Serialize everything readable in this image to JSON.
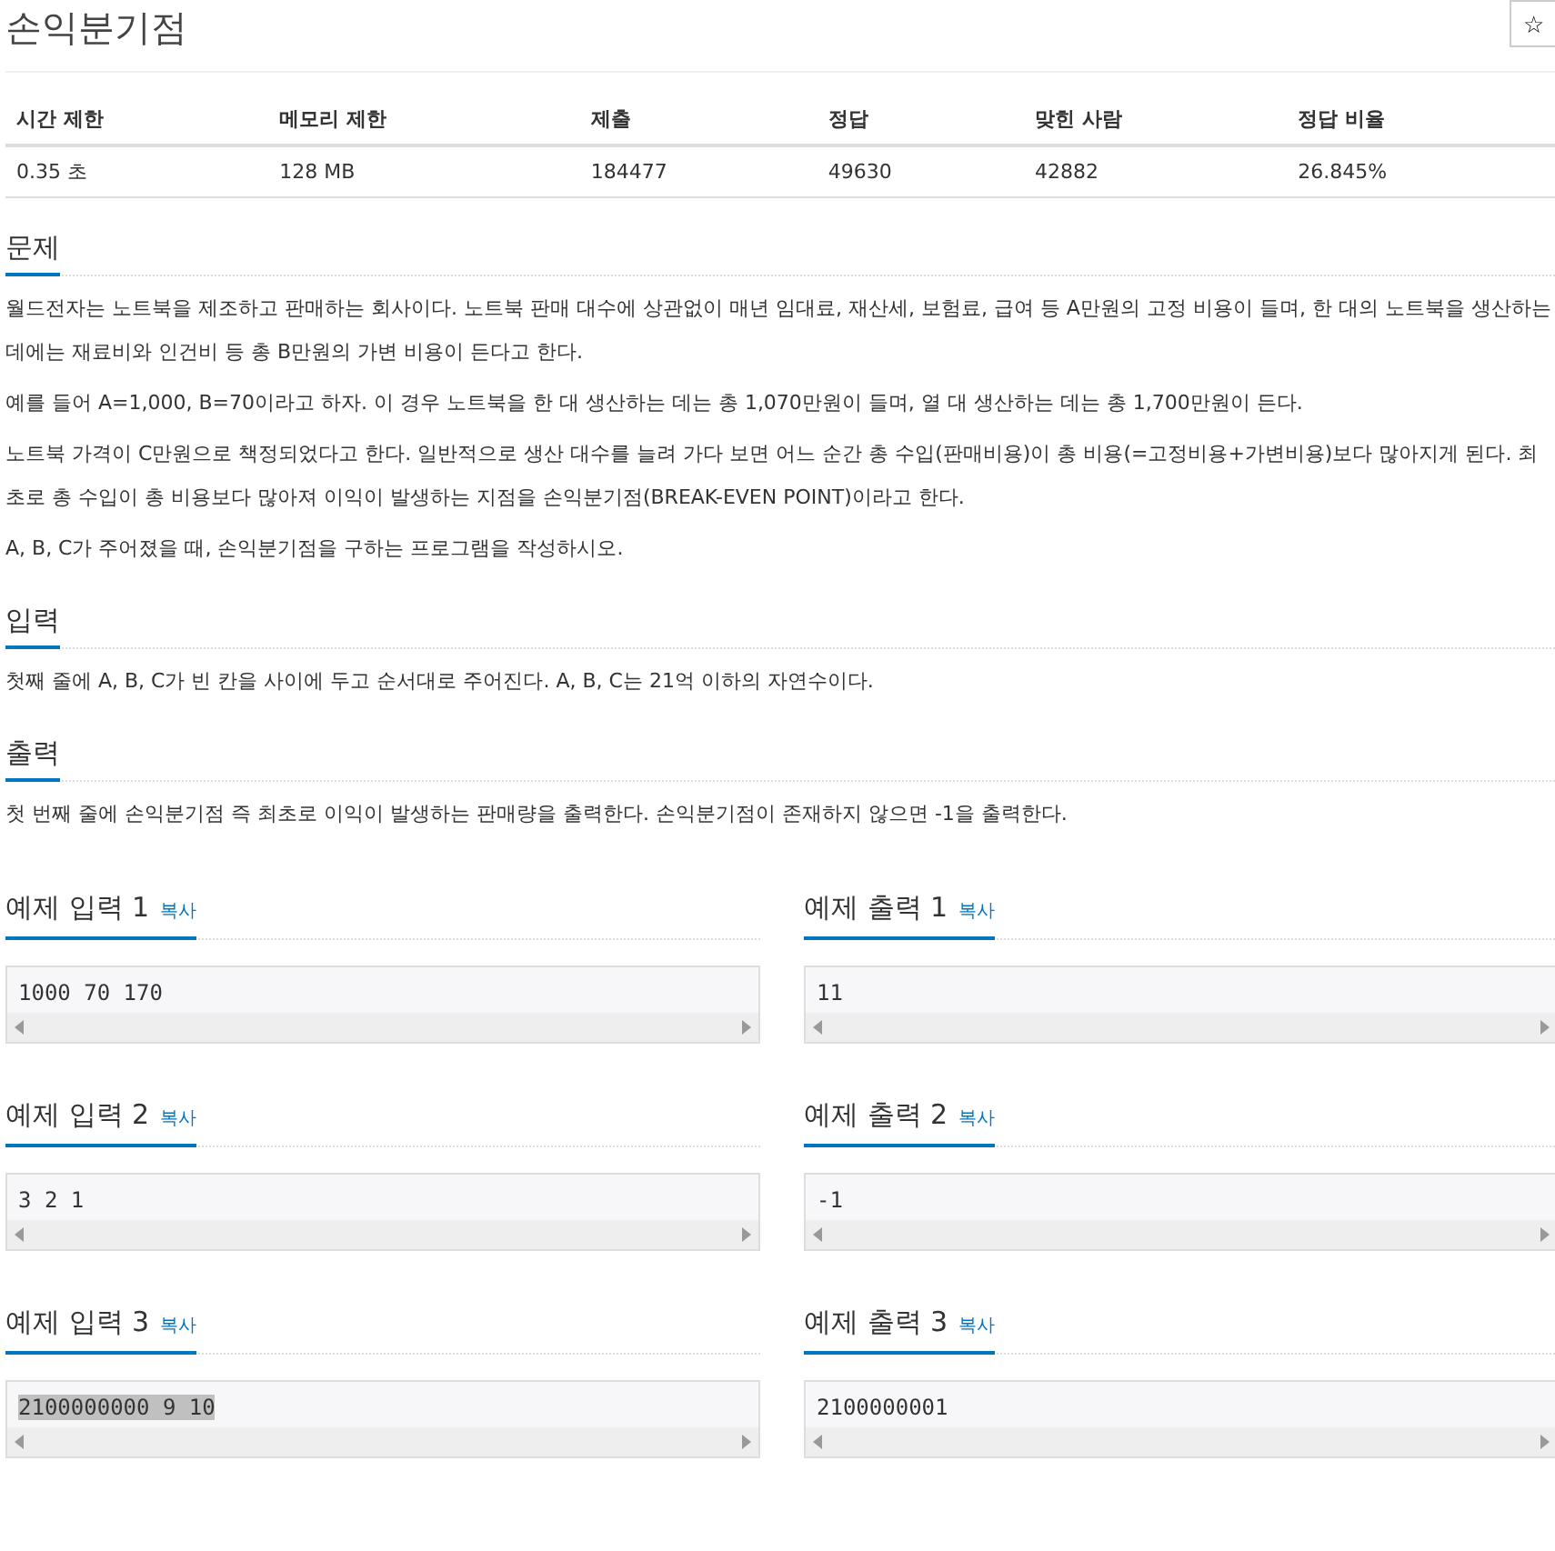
{
  "title": "손익분기점",
  "star_button": "☆",
  "info_table": {
    "columns": [
      "시간 제한",
      "메모리 제한",
      "제출",
      "정답",
      "맞힌 사람",
      "정답 비율"
    ],
    "row": [
      "0.35 초",
      "128 MB",
      "184477",
      "49630",
      "42882",
      "26.845%"
    ]
  },
  "sections": [
    {
      "heading": "문제",
      "paragraphs": [
        "월드전자는 노트북을 제조하고 판매하는 회사이다. 노트북 판매 대수에 상관없이 매년 임대료, 재산세, 보험료, 급여 등 A만원의 고정 비용이 들며, 한 대의 노트북을 생산하는 데에는 재료비와 인건비 등 총 B만원의 가변 비용이 든다고 한다.",
        "예를 들어 A=1,000, B=70이라고 하자. 이 경우 노트북을 한 대 생산하는 데는 총 1,070만원이 들며, 열 대 생산하는 데는 총 1,700만원이 든다.",
        "노트북 가격이 C만원으로 책정되었다고 한다. 일반적으로 생산 대수를 늘려 가다 보면 어느 순간 총 수입(판매비용)이 총 비용(=고정비용+가변비용)보다 많아지게 된다. 최초로 총 수입이 총 비용보다 많아져 이익이 발생하는 지점을 손익분기점(BREAK-EVEN POINT)이라고 한다.",
        "A, B, C가 주어졌을 때, 손익분기점을 구하는 프로그램을 작성하시오."
      ]
    },
    {
      "heading": "입력",
      "paragraphs": [
        "첫째 줄에 A, B, C가 빈 칸을 사이에 두고 순서대로 주어진다. A, B, C는 21억 이하의 자연수이다."
      ]
    },
    {
      "heading": "출력",
      "paragraphs": [
        "첫 번째 줄에 손익분기점 즉 최초로 이익이 발생하는 판매량을 출력한다. 손익분기점이 존재하지 않으면 -1을 출력한다."
      ]
    }
  ],
  "samples": [
    {
      "input": {
        "title": "예제 입력 1",
        "copy": "복사",
        "content": "1000 70 170",
        "highlighted": false
      },
      "output": {
        "title": "예제 출력 1",
        "copy": "복사",
        "content": "11",
        "highlighted": false
      }
    },
    {
      "input": {
        "title": "예제 입력 2",
        "copy": "복사",
        "content": "3 2 1",
        "highlighted": false
      },
      "output": {
        "title": "예제 출력 2",
        "copy": "복사",
        "content": "-1",
        "highlighted": false
      }
    },
    {
      "input": {
        "title": "예제 입력 3",
        "copy": "복사",
        "content": "2100000000 9 10",
        "highlighted": true
      },
      "output": {
        "title": "예제 출력 3",
        "copy": "복사",
        "content": "2100000001",
        "highlighted": false
      }
    }
  ]
}
